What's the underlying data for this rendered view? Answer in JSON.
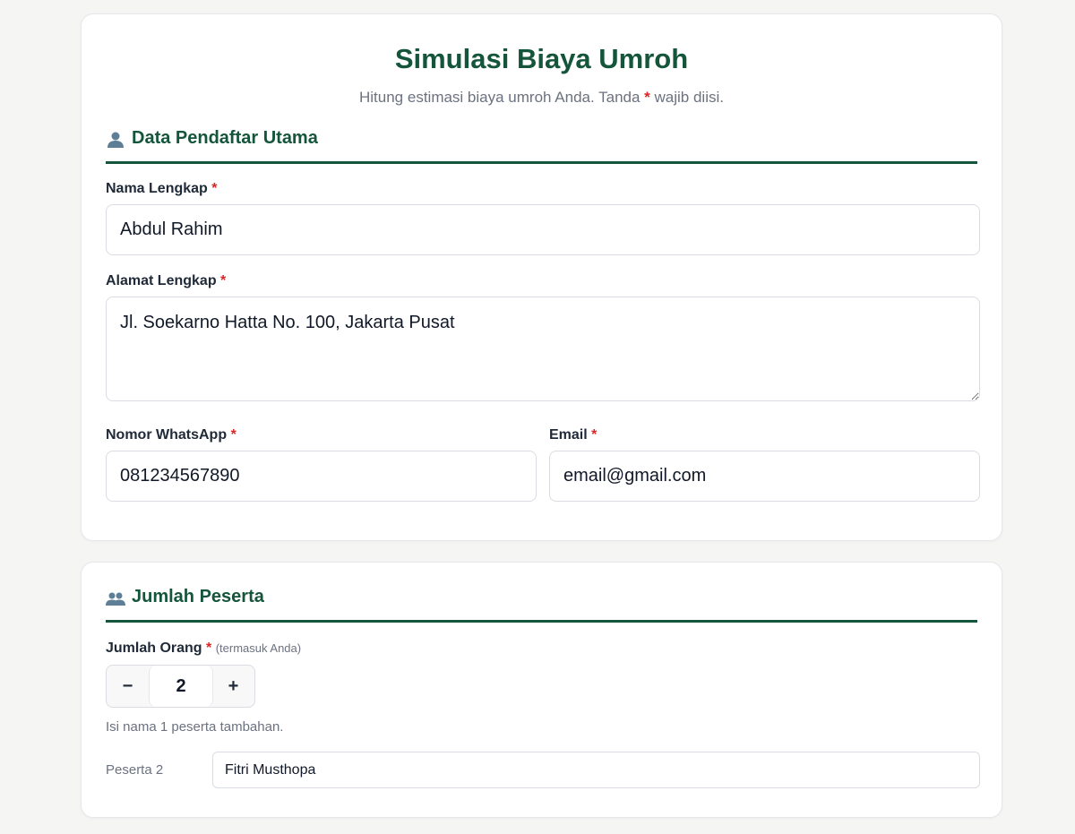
{
  "header": {
    "title": "Simulasi Biaya Umroh",
    "subtitle_pre": "Hitung estimasi biaya umroh Anda. Tanda ",
    "subtitle_mark": "*",
    "subtitle_post": " wajib diisi."
  },
  "section_primary": {
    "title": "Data Pendaftar Utama",
    "icon": "user-icon",
    "name": {
      "label": "Nama Lengkap",
      "required_mark": "*",
      "value": "Abdul Rahim"
    },
    "address": {
      "label": "Alamat Lengkap",
      "required_mark": "*",
      "value": "Jl. Soekarno Hatta No. 100, Jakarta Pusat"
    },
    "whatsapp": {
      "label": "Nomor WhatsApp",
      "required_mark": "*",
      "value": "081234567890"
    },
    "email": {
      "label": "Email",
      "required_mark": "*",
      "value": "email@gmail.com"
    }
  },
  "section_participants": {
    "title": "Jumlah Peserta",
    "icon": "users-icon",
    "count_label": "Jumlah Orang",
    "required_mark": "*",
    "count_hint": "(termasuk Anda)",
    "decrement_label": "−",
    "increment_label": "+",
    "count": "2",
    "helper": "Isi nama 1 peserta tambahan.",
    "participants": [
      {
        "label": "Peserta 2",
        "value": "Fitri Musthopa"
      }
    ]
  },
  "colors": {
    "accent": "#14553b",
    "required": "#dc2626",
    "muted_text": "#6b7280",
    "background": "#f5f5f3"
  }
}
